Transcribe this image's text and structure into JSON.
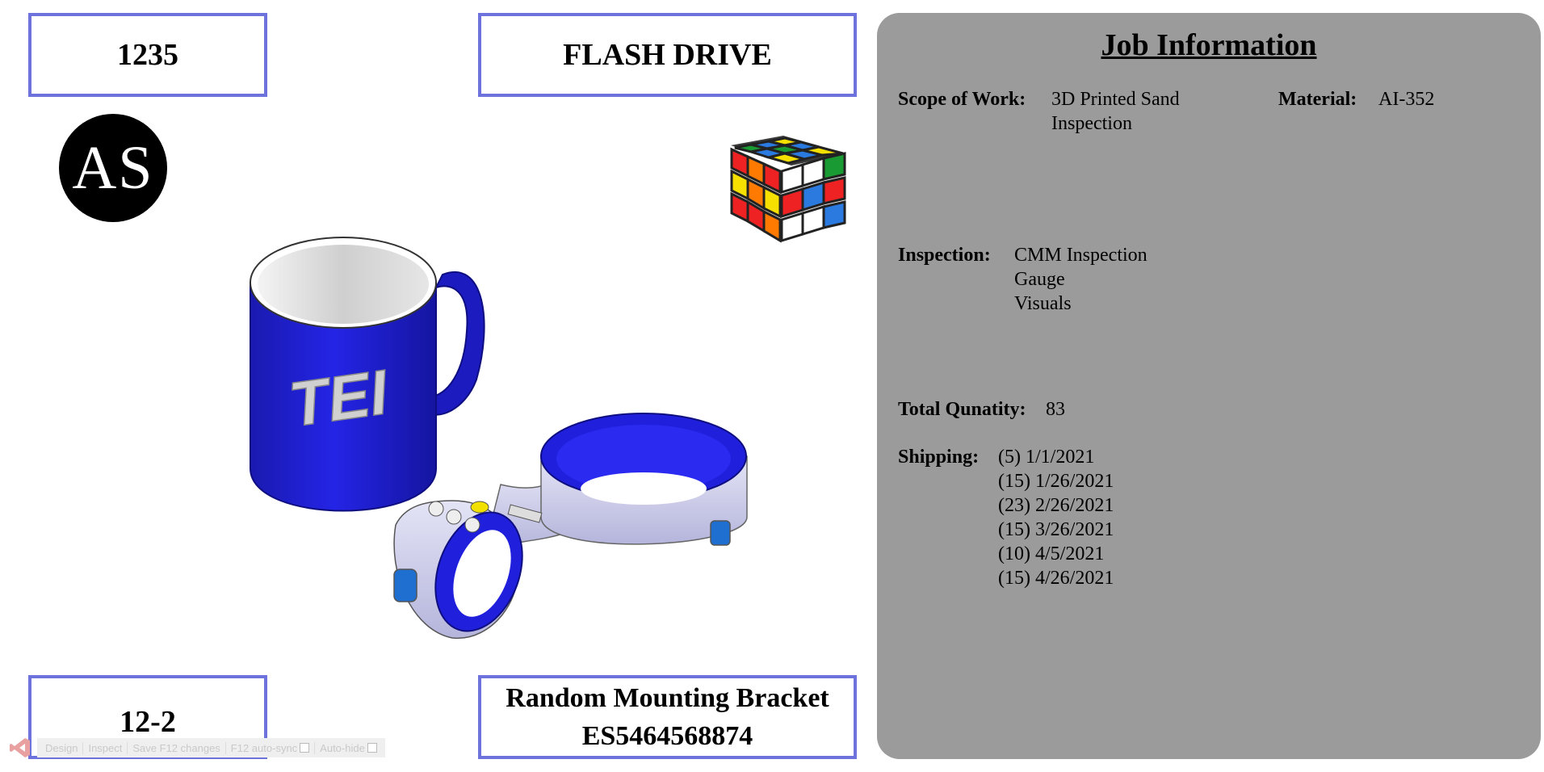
{
  "top_left_box": "1235",
  "top_center_box": "FLASH DRIVE",
  "bottom_left_box": "12-2",
  "bottom_center_box": {
    "line1": "Random Mounting Bracket",
    "line2": "ES5464568874"
  },
  "logo_text": "AS",
  "mug_text": "TEI",
  "job_info": {
    "title": "Job Information",
    "scope_label": "Scope of Work:",
    "scope_lines": [
      "3D Printed Sand",
      "Inspection"
    ],
    "material_label": "Material:",
    "material_value": "AI-352",
    "inspection_label": "Inspection:",
    "inspection_lines": [
      "CMM Inspection",
      "Gauge",
      "Visuals"
    ],
    "quantity_label": "Total Qunatity:",
    "quantity_value": "83",
    "shipping_label": "Shipping:",
    "shipping_lines": [
      "(5) 1/1/2021",
      "(15) 1/26/2021",
      "(23) 2/26/2021",
      "(15) 3/26/2021",
      "(10) 4/5/2021",
      "(15) 4/26/2021"
    ]
  },
  "devtools": {
    "design": "Design",
    "inspect": "Inspect",
    "save": "Save F12 changes",
    "autosync": "F12 auto-sync",
    "autohide": "Auto-hide"
  },
  "colors": {
    "box_border": "#6e72dc",
    "panel_bg": "#9b9b9b",
    "mug_blue": "#1c1ccc"
  }
}
